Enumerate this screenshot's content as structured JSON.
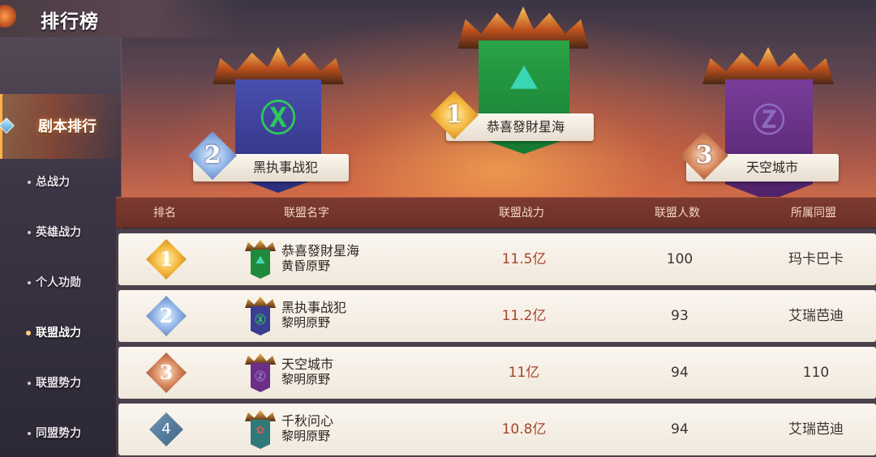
{
  "sidebar": {
    "title": "排行榜",
    "main_item": "剧本排行",
    "items": [
      {
        "label": "总战力",
        "active": false
      },
      {
        "label": "英雄战力",
        "active": false
      },
      {
        "label": "个人功勋",
        "active": false
      },
      {
        "label": "联盟战力",
        "active": true
      },
      {
        "label": "联盟势力",
        "active": false
      },
      {
        "label": "同盟势力",
        "active": false
      }
    ]
  },
  "podium": {
    "first": {
      "rank": "1",
      "name": "恭喜發財星海",
      "banner_color": "#1f8a3a"
    },
    "second": {
      "rank": "2",
      "name": "黑执事战犯",
      "banner_color": "#3a3d92"
    },
    "third": {
      "rank": "3",
      "name": "天空城市",
      "banner_color": "#6b2f86"
    }
  },
  "table": {
    "headers": [
      "排名",
      "联盟名字",
      "联盟战力",
      "联盟人数",
      "所属同盟"
    ],
    "rows": [
      {
        "rank": "1",
        "name": "恭喜發財星海",
        "server": "黄昏原野",
        "power": "11.5亿",
        "members": "100",
        "league": "玛卡巴卡",
        "banner_color": "#1f8a3a"
      },
      {
        "rank": "2",
        "name": "黑执事战犯",
        "server": "黎明原野",
        "power": "11.2亿",
        "members": "93",
        "league": "艾瑞芭迪",
        "banner_color": "#3a3d92"
      },
      {
        "rank": "3",
        "name": "天空城市",
        "server": "黎明原野",
        "power": "11亿",
        "members": "94",
        "league": "110",
        "banner_color": "#6b2f86"
      },
      {
        "rank": "4",
        "name": "千秋问心",
        "server": "黎明原野",
        "power": "10.8亿",
        "members": "94",
        "league": "艾瑞芭迪",
        "banner_color": "#2f7a78"
      }
    ]
  }
}
